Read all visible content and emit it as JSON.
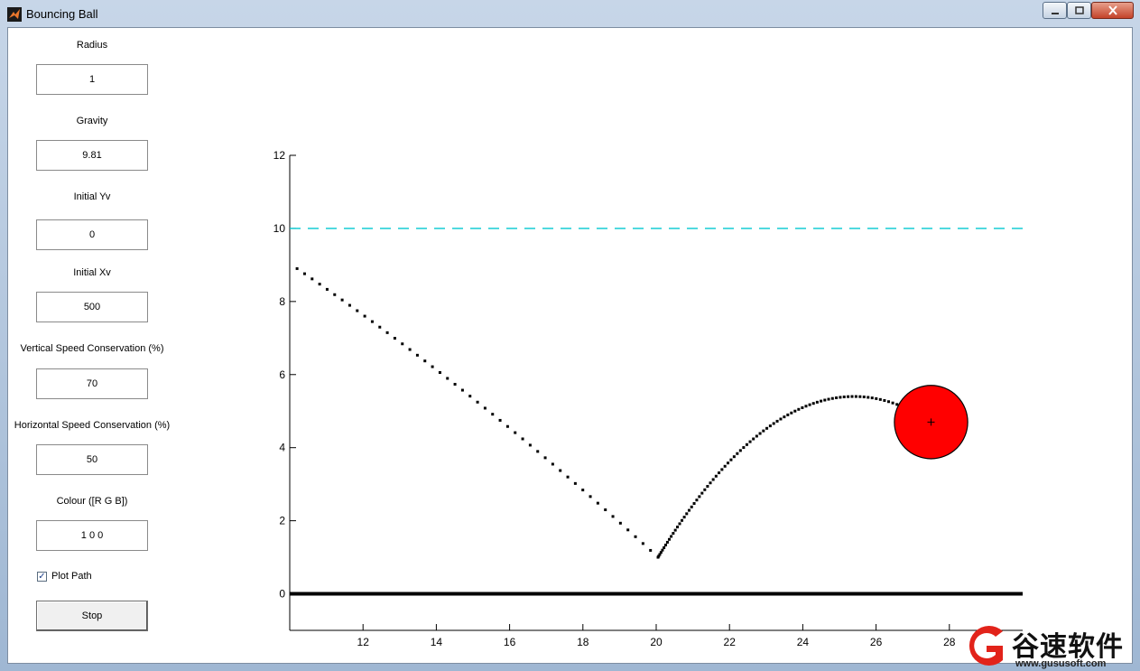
{
  "window": {
    "title": "Bouncing Ball",
    "minimize_icon": "minimize-icon",
    "maximize_icon": "maximize-icon",
    "close_icon": "close-icon"
  },
  "controls": {
    "radius_label": "Radius",
    "radius_value": "1",
    "gravity_label": "Gravity",
    "gravity_value": "9.81",
    "initial_yv_label": "Initial Yv",
    "initial_yv_value": "0",
    "initial_xv_label": "Initial Xv",
    "initial_xv_value": "500",
    "vertical_conservation_label": "Vertical Speed Conservation (%)",
    "vertical_conservation_value": "70",
    "horizontal_conservation_label": "Horizontal Speed Conservation (%)",
    "horizontal_conservation_value": "50",
    "colour_label": "Colour ([R G B])",
    "colour_value": "1 0 0",
    "plot_path_label": "Plot Path",
    "plot_path_checked": true,
    "stop_label": "Stop"
  },
  "chart_data": {
    "type": "scatter",
    "xlim": [
      10,
      30
    ],
    "ylim": [
      -1,
      12
    ],
    "x_ticks": [
      "12",
      "14",
      "16",
      "18",
      "20",
      "22",
      "24",
      "26",
      "28"
    ],
    "y_ticks": [
      "0",
      "2",
      "4",
      "6",
      "8",
      "10",
      "12"
    ],
    "ground_line_y": 0,
    "ceiling_dashed_y": 10,
    "ceiling_color": "#00c8d0",
    "ball": {
      "x": 27.5,
      "y": 4.7,
      "radius": 1,
      "color": "#ff0000"
    },
    "path_segments": [
      {
        "x_start": 10.2,
        "x_end": 20.05,
        "y_start": 8.9,
        "y_end": 1.0
      },
      {
        "x_start": 20.05,
        "x_end": 27.5,
        "y_start": 1.0,
        "y_end": 4.7,
        "apex_x": 25.4,
        "apex_y": 5.4
      }
    ],
    "grid": false
  },
  "watermark": {
    "text": "谷速软件",
    "url": "www.gususoft.com"
  }
}
